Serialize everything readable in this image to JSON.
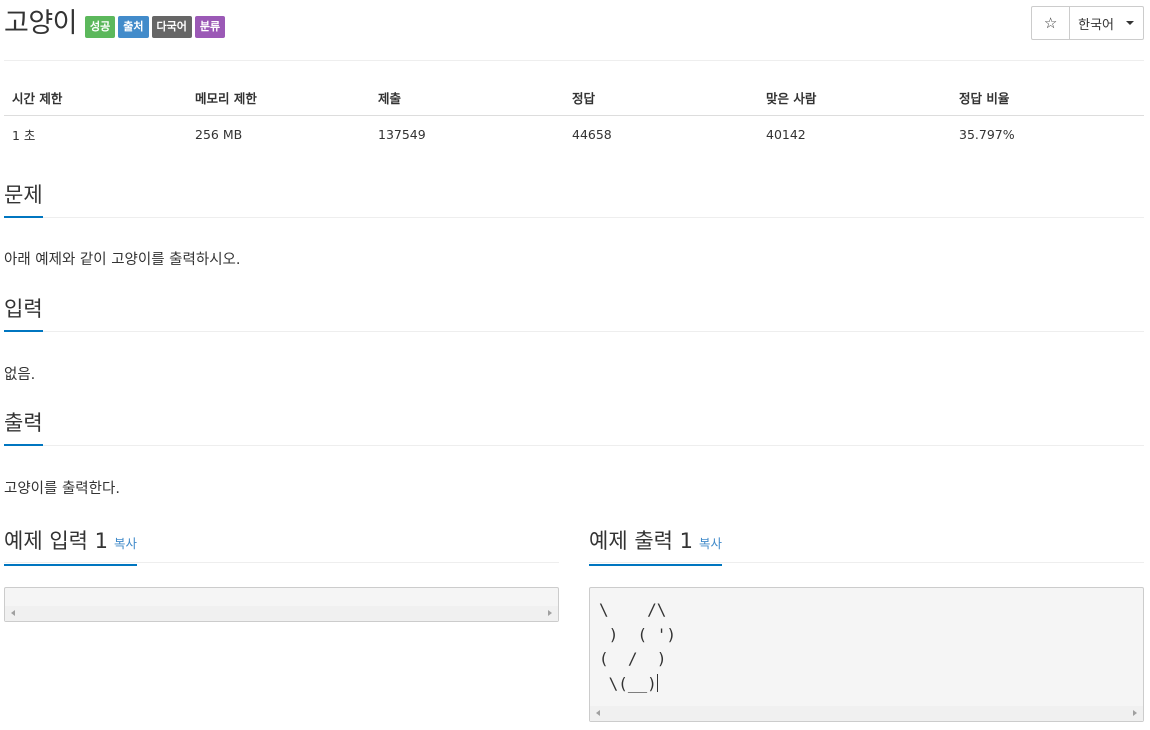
{
  "problem": {
    "title": "고양이",
    "badges": {
      "success": "성공",
      "source": "출처",
      "multilang": "다국어",
      "category": "분류"
    }
  },
  "actions": {
    "star_glyph": "☆",
    "language": "한국어"
  },
  "stats": {
    "headers": [
      "시간 제한",
      "메모리 제한",
      "제출",
      "정답",
      "맞은 사람",
      "정답 비율"
    ],
    "values": [
      "1 초",
      "256 MB",
      "137549",
      "44658",
      "40142",
      "35.797%"
    ]
  },
  "sections": {
    "description": {
      "title": "문제",
      "text": "아래 예제와 같이 고양이를 출력하시오."
    },
    "input": {
      "title": "입력",
      "text": "없음."
    },
    "output": {
      "title": "출력",
      "text": "고양이를 출력한다."
    }
  },
  "samples": {
    "input_title": "예제 입력 1",
    "output_title": "예제 출력 1",
    "copy_label": "복사",
    "input_text": "",
    "output_lines": [
      "\\    /\\",
      " )  ( ')",
      "(  /  )",
      " \\(__)"
    ]
  },
  "colors": {
    "accent": "#0076c0",
    "badge_success": "#5cb85c",
    "badge_source": "#428bca",
    "badge_multilang": "#666666",
    "badge_category": "#9b59b6"
  }
}
